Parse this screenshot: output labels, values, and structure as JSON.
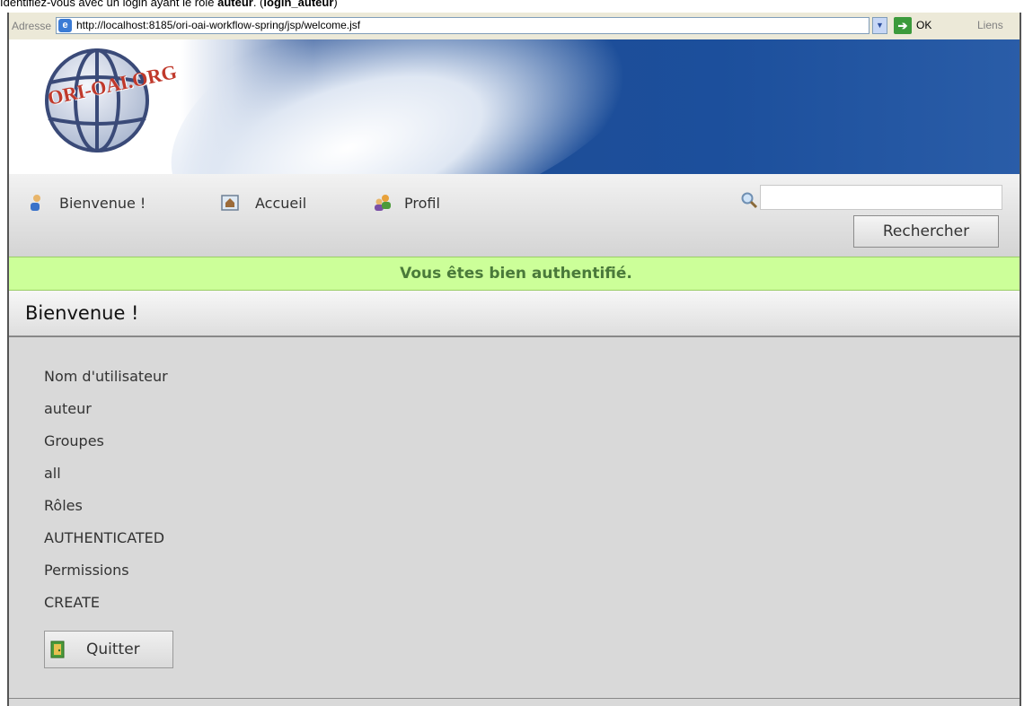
{
  "caption": {
    "prefix": "Identifiez-vous avec un login ayant le rôle ",
    "role": "auteur",
    "middle": ". (",
    "login": "login_auteur",
    "suffix": ")"
  },
  "browser": {
    "address_label": "Adresse",
    "url": "http://localhost:8185/ori-oai-workflow-spring/jsp/welcome.jsf",
    "go_label": "OK",
    "links_label": "Liens"
  },
  "banner": {
    "logo_text": "ORI-OAI.ORG"
  },
  "nav": {
    "items": [
      {
        "label": "Bienvenue !",
        "icon": "user-icon"
      },
      {
        "label": "Accueil",
        "icon": "home-icon"
      },
      {
        "label": "Profil",
        "icon": "profile-icon"
      }
    ],
    "search_value": "",
    "search_button": "Rechercher"
  },
  "message": "Vous êtes bien authentifié.",
  "section_title": "Bienvenue !",
  "fields": [
    "Nom d'utilisateur",
    "auteur",
    "Groupes",
    "all",
    "Rôles",
    "AUTHENTICATED",
    "Permissions",
    "CREATE"
  ],
  "quit_button": "Quitter",
  "colors": {
    "message_bg": "#ccff99",
    "banner_blue": "#1e4d96"
  }
}
